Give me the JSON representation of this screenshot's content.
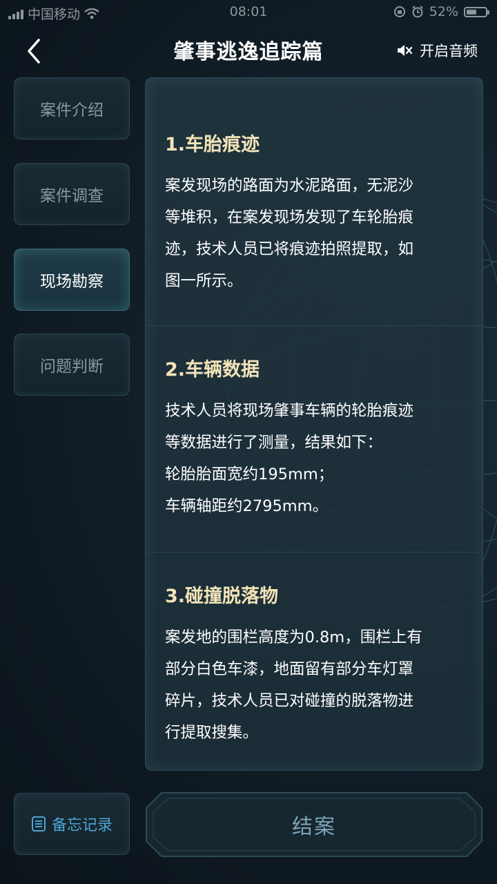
{
  "status_bar": {
    "carrier": "中国移动",
    "time": "08:01",
    "battery": "52%",
    "battery_level": 0.52
  },
  "header": {
    "title": "肇事逃逸追踪篇",
    "sound_label": "开启音频",
    "back_icon": "chevron-left-icon",
    "sound_icon": "speaker-muted-icon"
  },
  "tabs": [
    {
      "label": "案件介绍",
      "active": false
    },
    {
      "label": "案件调查",
      "active": false
    },
    {
      "label": "现场勘察",
      "active": true
    },
    {
      "label": "问题判断",
      "active": false
    }
  ],
  "sections": [
    {
      "heading": "1.车胎痕迹",
      "lines": [
        "案发现场的路面为水泥路面，无泥沙",
        "等堆积，在案发现场发现了车轮胎痕",
        "迹，技术人员已将痕迹拍照提取，如",
        "图一所示。"
      ]
    },
    {
      "heading": "2.车辆数据",
      "lines": [
        "技术人员将现场肇事车辆的轮胎痕迹",
        "等数据进行了测量，结果如下：",
        "轮胎胎面宽约195mm；",
        "车辆轴距约2795mm。"
      ]
    },
    {
      "heading": "3.碰撞脱落物",
      "lines": [
        "案发地的围栏高度为0.8m，围栏上有",
        "部分白色车漆，地面留有部分车灯罩",
        "碎片，技术人员已对碰撞的脱落物进",
        "行提取搜集。"
      ]
    }
  ],
  "footer": {
    "memo_label": "备忘记录",
    "memo_icon": "list-icon",
    "close_case_label": "结案"
  },
  "colors": {
    "heading": "#f2e3b8",
    "memo": "#4aa6d6",
    "active_tab_text": "#ffffff",
    "inactive_tab_text": "#8a999f"
  }
}
